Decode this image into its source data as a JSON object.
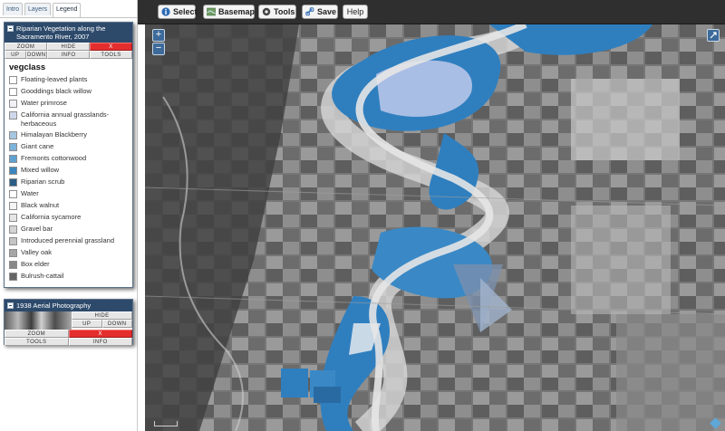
{
  "tabs": [
    {
      "label": "Intro"
    },
    {
      "label": "Layers"
    },
    {
      "label": "Legend"
    }
  ],
  "toolbar": {
    "select": "Select",
    "basemap": "Basemap",
    "tools": "Tools",
    "save": "Save",
    "help": "Help"
  },
  "layer1": {
    "title": "Riparian Vegetation along the Sacramento River, 2007",
    "buttons": {
      "zoom": "ZOOM",
      "hide": "HIDE",
      "close": "X",
      "up": "UP",
      "down": "DOWN",
      "info": "INFO",
      "tools": "TOOLS"
    },
    "legend_title": "vegclass",
    "legend": [
      {
        "label": "Floating-leaved plants",
        "color": "#ffffff"
      },
      {
        "label": "Gooddings black willow",
        "color": "#ffffff"
      },
      {
        "label": "Water primrose",
        "color": "#f1f1f7"
      },
      {
        "label": "California annual grasslands-herbaceous",
        "color": "#cfd7ea"
      },
      {
        "label": "Himalayan Blackberry",
        "color": "#a7c6e2"
      },
      {
        "label": "Giant cane",
        "color": "#7db3d9"
      },
      {
        "label": "Fremonts cottonwood",
        "color": "#5fa2d1"
      },
      {
        "label": "Mixed willow",
        "color": "#3c86bd"
      },
      {
        "label": "Riparian scrub",
        "color": "#2a5e86"
      },
      {
        "label": "Water",
        "color": "#ffffff"
      },
      {
        "label": "Black walnut",
        "color": "#f4f4f4"
      },
      {
        "label": "California sycamore",
        "color": "#e6e6e6"
      },
      {
        "label": "Gravel bar",
        "color": "#d4d4d4"
      },
      {
        "label": "Introduced perennial grassland",
        "color": "#c4c4c4"
      },
      {
        "label": "Valley oak",
        "color": "#a6a6a6"
      },
      {
        "label": "Box elder",
        "color": "#888888"
      },
      {
        "label": "Bulrush-cattail",
        "color": "#666666"
      }
    ]
  },
  "layer2": {
    "title": "1938 Aerial Photography",
    "buttons": {
      "hide": "HIDE",
      "up": "UP",
      "down": "DOWN",
      "zoom": "ZOOM",
      "close": "X",
      "tools": "TOOLS",
      "info": "INFO"
    }
  },
  "map": {
    "zoom_in": "+",
    "zoom_out": "−"
  },
  "colors": {
    "panel_header": "#2d4a6b",
    "toolbar": "#2f2f2f",
    "close_button": "#e42e2e",
    "vegetation_blue": "#2f7fbf"
  }
}
